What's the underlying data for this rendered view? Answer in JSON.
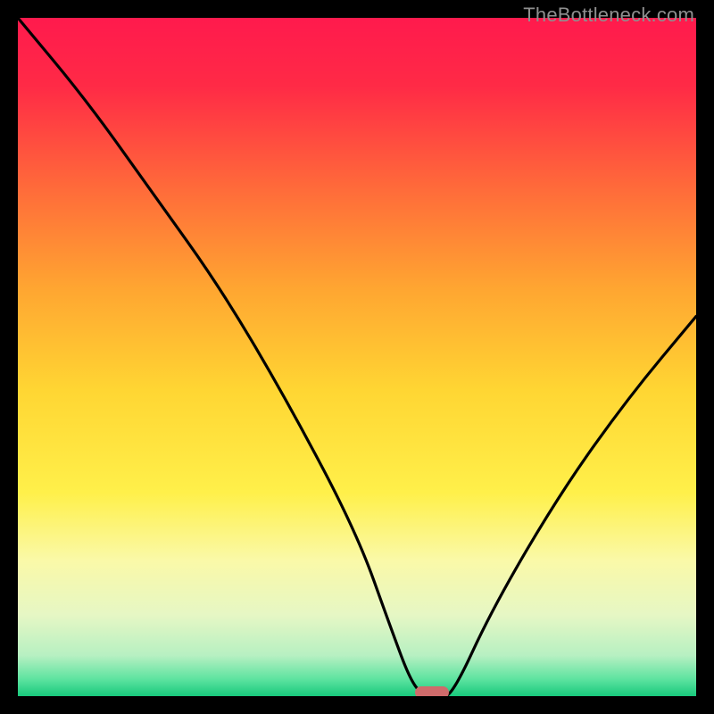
{
  "watermark": {
    "text": "TheBottleneck.com"
  },
  "chart_data": {
    "type": "line",
    "title": "",
    "xlabel": "",
    "ylabel": "",
    "ylim": [
      0,
      100
    ],
    "xlim": [
      0,
      100
    ],
    "series": [
      {
        "name": "bottleneck-curve",
        "x": [
          0,
          10,
          20,
          30,
          40,
          50,
          55,
          58,
          60,
          62,
          64,
          70,
          80,
          90,
          100
        ],
        "values": [
          100,
          88,
          74,
          60,
          43,
          24,
          10,
          2,
          0,
          0,
          0,
          13,
          30,
          44,
          56
        ]
      }
    ],
    "gradient_stops": [
      {
        "pos": 0.0,
        "color": "#ff1a4d"
      },
      {
        "pos": 0.1,
        "color": "#ff2a46"
      },
      {
        "pos": 0.25,
        "color": "#ff6a3a"
      },
      {
        "pos": 0.4,
        "color": "#ffa631"
      },
      {
        "pos": 0.55,
        "color": "#ffd633"
      },
      {
        "pos": 0.7,
        "color": "#fff04a"
      },
      {
        "pos": 0.8,
        "color": "#faf9a8"
      },
      {
        "pos": 0.88,
        "color": "#e6f7c4"
      },
      {
        "pos": 0.94,
        "color": "#b7f0c2"
      },
      {
        "pos": 0.975,
        "color": "#5de3a0"
      },
      {
        "pos": 1.0,
        "color": "#18c97c"
      }
    ],
    "marker": {
      "name": "optimal-zone-marker",
      "x_center": 61,
      "width_x": 5,
      "y": 0.5,
      "color": "#cf6b6b"
    }
  }
}
